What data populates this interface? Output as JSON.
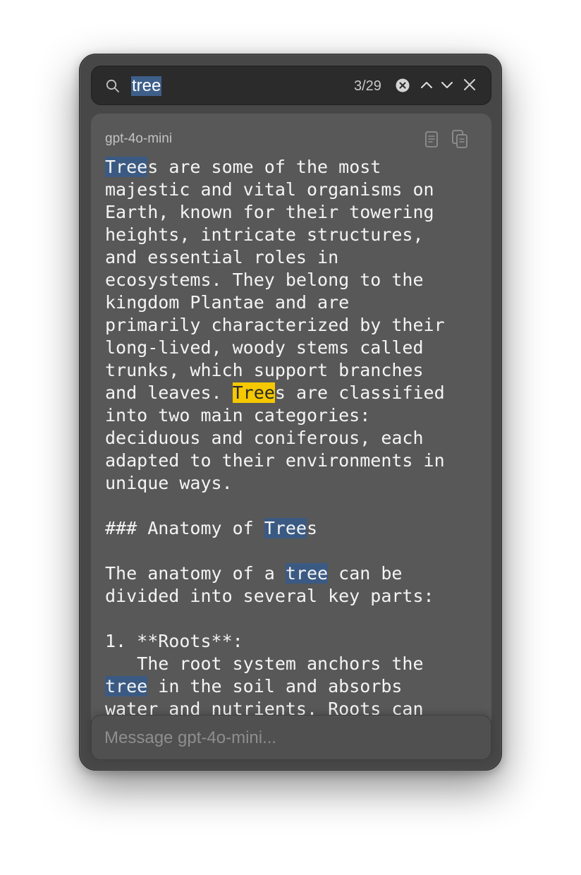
{
  "search": {
    "query": "tree",
    "match_count": "3/29"
  },
  "message": {
    "model": "gpt-4o-mini",
    "lines": [
      [
        {
          "t": "Tree",
          "h": "match"
        },
        {
          "t": "s are some of the most"
        }
      ],
      [
        {
          "t": "majestic and vital organisms on"
        }
      ],
      [
        {
          "t": "Earth, known for their towering"
        }
      ],
      [
        {
          "t": "heights, intricate structures,"
        }
      ],
      [
        {
          "t": "and essential roles in"
        }
      ],
      [
        {
          "t": "ecosystems. They belong to the"
        }
      ],
      [
        {
          "t": "kingdom Plantae and are"
        }
      ],
      [
        {
          "t": "primarily characterized by their"
        }
      ],
      [
        {
          "t": "long-lived, woody stems called"
        }
      ],
      [
        {
          "t": "trunks, which support branches"
        }
      ],
      [
        {
          "t": "and leaves. "
        },
        {
          "t": "Tree",
          "h": "current"
        },
        {
          "t": "s are classified"
        }
      ],
      [
        {
          "t": "into two main categories:"
        }
      ],
      [
        {
          "t": "deciduous and coniferous, each"
        }
      ],
      [
        {
          "t": "adapted to their environments in"
        }
      ],
      [
        {
          "t": "unique ways."
        }
      ],
      [
        {
          "t": ""
        }
      ],
      [
        {
          "t": "### Anatomy of "
        },
        {
          "t": "Tree",
          "h": "match"
        },
        {
          "t": "s"
        }
      ],
      [
        {
          "t": ""
        }
      ],
      [
        {
          "t": "The anatomy of a "
        },
        {
          "t": "tree",
          "h": "match"
        },
        {
          "t": " can be"
        }
      ],
      [
        {
          "t": "divided into several key parts:"
        }
      ],
      [
        {
          "t": ""
        }
      ],
      [
        {
          "t": "1. **Roots**:"
        }
      ],
      [
        {
          "t": "   The root system anchors the"
        }
      ],
      [
        {
          "t": "tree",
          "h": "match"
        },
        {
          "t": " in the soil and absorbs"
        }
      ],
      [
        {
          "t": "water and nutrients. Roots can"
        }
      ]
    ]
  },
  "composer": {
    "placeholder": "Message gpt-4o-mini..."
  },
  "colors": {
    "match_highlight": "#3b5a83",
    "current_match_highlight": "#f5c800"
  },
  "icons": [
    "search-icon",
    "clear-search-icon",
    "chevron-up-icon",
    "chevron-down-icon",
    "close-icon",
    "document-icon",
    "copy-icon"
  ]
}
